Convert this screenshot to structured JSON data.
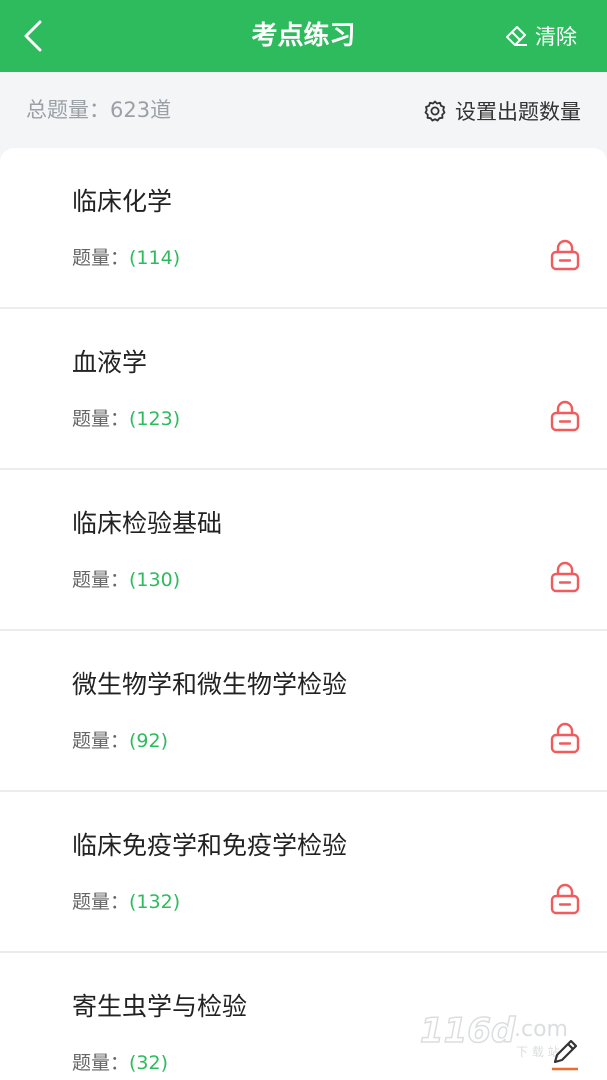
{
  "header": {
    "back_icon": "chevron-left-icon",
    "title": "考点练习",
    "clear_label": "清除",
    "clear_icon": "eraser-icon"
  },
  "summary": {
    "total_label": "总题量：",
    "total_value": "623道",
    "settings_icon": "gear-icon",
    "settings_label": "设置出题数量"
  },
  "items": [
    {
      "title": "临床化学",
      "count_label": "题量：",
      "count": "(114)",
      "locked": true
    },
    {
      "title": "血液学",
      "count_label": "题量：",
      "count": "(123)",
      "locked": true
    },
    {
      "title": "临床检验基础",
      "count_label": "题量：",
      "count": "(130)",
      "locked": true
    },
    {
      "title": "微生物学和微生物学检验",
      "count_label": "题量：",
      "count": "(92)",
      "locked": true
    },
    {
      "title": "临床免疫学和免疫学检验",
      "count_label": "题量：",
      "count": "(132)",
      "locked": true
    },
    {
      "title": "寄生虫学与检验",
      "count_label": "题量：",
      "count": "(32)",
      "locked": false
    }
  ],
  "watermark": {
    "text": "116d.com",
    "sub": "下 载 站"
  },
  "colors": {
    "primary": "#2dbb5d",
    "lock": "#f15b5b",
    "muted": "#9aa0a6"
  }
}
